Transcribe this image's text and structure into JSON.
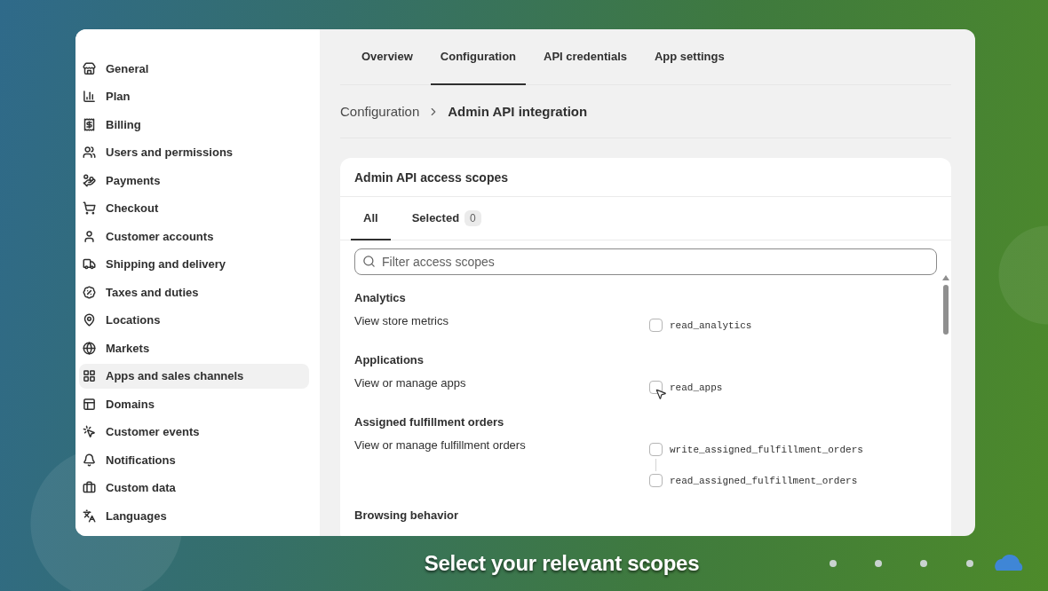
{
  "sidebar": {
    "items": [
      {
        "label": "General",
        "selected": false
      },
      {
        "label": "Plan",
        "selected": false
      },
      {
        "label": "Billing",
        "selected": false
      },
      {
        "label": "Users and permissions",
        "selected": false
      },
      {
        "label": "Payments",
        "selected": false
      },
      {
        "label": "Checkout",
        "selected": false
      },
      {
        "label": "Customer accounts",
        "selected": false
      },
      {
        "label": "Shipping and delivery",
        "selected": false
      },
      {
        "label": "Taxes and duties",
        "selected": false
      },
      {
        "label": "Locations",
        "selected": false
      },
      {
        "label": "Markets",
        "selected": false
      },
      {
        "label": "Apps and sales channels",
        "selected": true
      },
      {
        "label": "Domains",
        "selected": false
      },
      {
        "label": "Customer events",
        "selected": false
      },
      {
        "label": "Notifications",
        "selected": false
      },
      {
        "label": "Custom data",
        "selected": false
      },
      {
        "label": "Languages",
        "selected": false
      }
    ]
  },
  "tabs": [
    {
      "label": "Overview",
      "selected": false
    },
    {
      "label": "Configuration",
      "selected": true
    },
    {
      "label": "API credentials",
      "selected": false
    },
    {
      "label": "App settings",
      "selected": false
    }
  ],
  "breadcrumb": {
    "parent": "Configuration",
    "current": "Admin API integration"
  },
  "scopes_card": {
    "title": "Admin API access scopes",
    "filter_tabs": [
      {
        "label": "All",
        "selected": true
      },
      {
        "label": "Selected",
        "count": "0",
        "selected": false
      }
    ],
    "search": {
      "placeholder": "Filter access scopes"
    },
    "sections": [
      {
        "heading": "Analytics",
        "description": "View store metrics",
        "scopes": [
          {
            "name": "read_analytics",
            "checked": false
          }
        ]
      },
      {
        "heading": "Applications",
        "description": "View or manage apps",
        "scopes": [
          {
            "name": "read_apps",
            "checked": false
          }
        ]
      },
      {
        "heading": "Assigned fulfillment orders",
        "description": "View or manage fulfillment orders",
        "scopes": [
          {
            "name": "write_assigned_fulfillment_orders",
            "checked": false
          },
          {
            "name": "read_assigned_fulfillment_orders",
            "checked": false
          }
        ]
      },
      {
        "heading": "Browsing behavior"
      }
    ]
  },
  "caption": "Select your relevant scopes"
}
